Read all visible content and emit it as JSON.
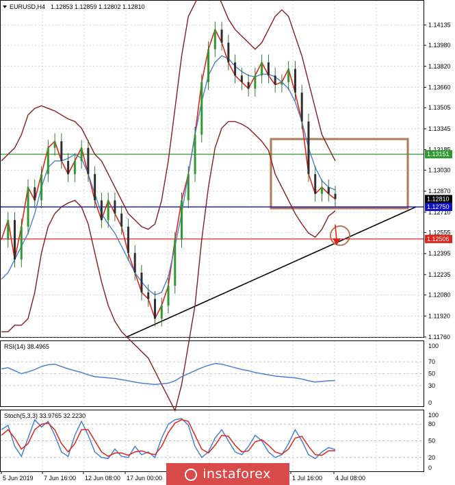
{
  "chart_data": {
    "type": "line",
    "header": {
      "symbol": "EURUSD,H4",
      "open": "1.12853",
      "high": "1.12859",
      "low": "1.12802",
      "close": "1.12810"
    },
    "price_axis": {
      "ylim": [
        1.1176,
        1.1421
      ],
      "ticks": [
        "1.14135",
        "1.13980",
        "1.13820",
        "1.13660",
        "1.13505",
        "1.13345",
        "1.13185",
        "1.13030",
        "1.12870",
        "1.12710",
        "1.12555",
        "1.12395",
        "1.12235",
        "1.12080",
        "1.11920",
        "1.11760"
      ]
    },
    "x_axis": {
      "ticks": [
        "5 Jun 2019",
        "7 Jun 16:00",
        "12 Jun 08:00",
        "17 Jun 00:00",
        "1 Jul 16:00",
        "4 Jul 08:00"
      ]
    },
    "price_labels": [
      {
        "value": "1.13151",
        "color": "#2e9a2e"
      },
      {
        "value": "1.12810",
        "color": "#000000"
      },
      {
        "value": "1.12750",
        "color": "#1010c8"
      },
      {
        "value": "1.12506",
        "color": "#e0241b"
      }
    ],
    "levels": [
      {
        "price": 1.13151,
        "color": "#2e9a2e"
      },
      {
        "price": 1.1275,
        "color": "#1010c8"
      },
      {
        "price": 1.12506,
        "color": "#e0241b"
      }
    ],
    "series": [
      {
        "role": "close",
        "color": "#e0241b",
        "values": [
          1.125,
          1.1265,
          1.1235,
          1.126,
          1.129,
          1.128,
          1.13,
          1.132,
          1.1325,
          1.131,
          1.13,
          1.131,
          1.132,
          1.13,
          1.128,
          1.1265,
          1.128,
          1.127,
          1.126,
          1.124,
          1.1225,
          1.121,
          1.1205,
          1.119,
          1.12,
          1.1215,
          1.125,
          1.128,
          1.13,
          1.133,
          1.137,
          1.1395,
          1.141,
          1.14,
          1.1385,
          1.1375,
          1.137,
          1.1365,
          1.1375,
          1.1385,
          1.1375,
          1.1368,
          1.137,
          1.138,
          1.1362,
          1.134,
          1.13,
          1.1285,
          1.129,
          1.1285,
          1.1281
        ]
      },
      {
        "role": "ma-blue",
        "color": "#4a7fd4",
        "values": [
          1.122,
          1.1225,
          1.1235,
          1.1245,
          1.1255,
          1.127,
          1.129,
          1.1305,
          1.131,
          1.131,
          1.1312,
          1.1315,
          1.1312,
          1.13,
          1.1285,
          1.127,
          1.1262,
          1.1255,
          1.1245,
          1.1235,
          1.1225,
          1.1218,
          1.1212,
          1.1208,
          1.121,
          1.1222,
          1.1245,
          1.127,
          1.13,
          1.133,
          1.1355,
          1.1375,
          1.1385,
          1.139,
          1.1388,
          1.1382,
          1.1378,
          1.1375,
          1.1374,
          1.1376,
          1.1376,
          1.1374,
          1.137,
          1.1365,
          1.1355,
          1.134,
          1.132,
          1.1305,
          1.1295,
          1.129,
          1.1288
        ]
      },
      {
        "role": "bb-upper",
        "color": "#8b1a1a",
        "values": [
          1.131,
          1.1315,
          1.132,
          1.133,
          1.1345,
          1.135,
          1.1352,
          1.135,
          1.1348,
          1.1345,
          1.1342,
          1.134,
          1.1335,
          1.1325,
          1.1315,
          1.131,
          1.13,
          1.129,
          1.128,
          1.127,
          1.1265,
          1.126,
          1.1258,
          1.1262,
          1.128,
          1.131,
          1.135,
          1.139,
          1.142,
          1.143,
          1.144,
          1.1445,
          1.144,
          1.143,
          1.1418,
          1.141,
          1.1405,
          1.14,
          1.1395,
          1.14,
          1.141,
          1.142,
          1.1425,
          1.142,
          1.1405,
          1.139,
          1.137,
          1.135,
          1.133,
          1.132,
          1.131
        ]
      },
      {
        "role": "bb-lower",
        "color": "#8b1a1a",
        "values": [
          1.118,
          1.118,
          1.1185,
          1.1185,
          1.119,
          1.121,
          1.124,
          1.126,
          1.127,
          1.1275,
          1.1278,
          1.128,
          1.1275,
          1.1262,
          1.124,
          1.1218,
          1.12,
          1.1188,
          1.118,
          1.1175,
          1.117,
          1.1165,
          1.116,
          1.115,
          1.114,
          1.113,
          1.112,
          1.114,
          1.117,
          1.12,
          1.125,
          1.129,
          1.132,
          1.1335,
          1.134,
          1.134,
          1.1338,
          1.1335,
          1.133,
          1.1325,
          1.1318,
          1.13,
          1.129,
          1.128,
          1.127,
          1.1262,
          1.1255,
          1.1252,
          1.1258,
          1.1268,
          1.1272
        ]
      }
    ],
    "rsi": {
      "label": "RSI(14) 38.4965",
      "levels": [
        "70",
        "50",
        "30"
      ],
      "scale": [
        "100",
        "0"
      ],
      "values": [
        58,
        60,
        55,
        50,
        53,
        57,
        62,
        65,
        66,
        62,
        58,
        55,
        52,
        48,
        45,
        44,
        43,
        42,
        40,
        38,
        36,
        34,
        33,
        32,
        33,
        34,
        38,
        45,
        50,
        55,
        60,
        64,
        67,
        66,
        63,
        60,
        57,
        55,
        52,
        50,
        48,
        46,
        45,
        44,
        43,
        41,
        38,
        36,
        37,
        38,
        38.5
      ]
    },
    "stoch": {
      "label": "Stoch(5,3,3) 33.9765 32.2230",
      "levels": [
        "80",
        "50",
        "20"
      ],
      "scale": [
        "100",
        "0"
      ],
      "k": [
        70,
        78,
        40,
        22,
        55,
        88,
        75,
        85,
        60,
        30,
        22,
        60,
        85,
        60,
        30,
        20,
        18,
        35,
        22,
        20,
        40,
        25,
        30,
        20,
        55,
        80,
        88,
        90,
        78,
        40,
        20,
        30,
        55,
        70,
        50,
        30,
        25,
        40,
        60,
        50,
        30,
        20,
        25,
        45,
        70,
        50,
        25,
        18,
        30,
        38,
        34
      ],
      "d": [
        60,
        70,
        55,
        35,
        45,
        70,
        80,
        82,
        70,
        45,
        30,
        45,
        70,
        70,
        50,
        30,
        22,
        28,
        28,
        24,
        30,
        32,
        28,
        25,
        40,
        65,
        82,
        88,
        85,
        60,
        35,
        28,
        42,
        60,
        58,
        42,
        30,
        32,
        48,
        52,
        42,
        30,
        26,
        35,
        55,
        58,
        40,
        25,
        24,
        32,
        32.2
      ]
    }
  }
}
